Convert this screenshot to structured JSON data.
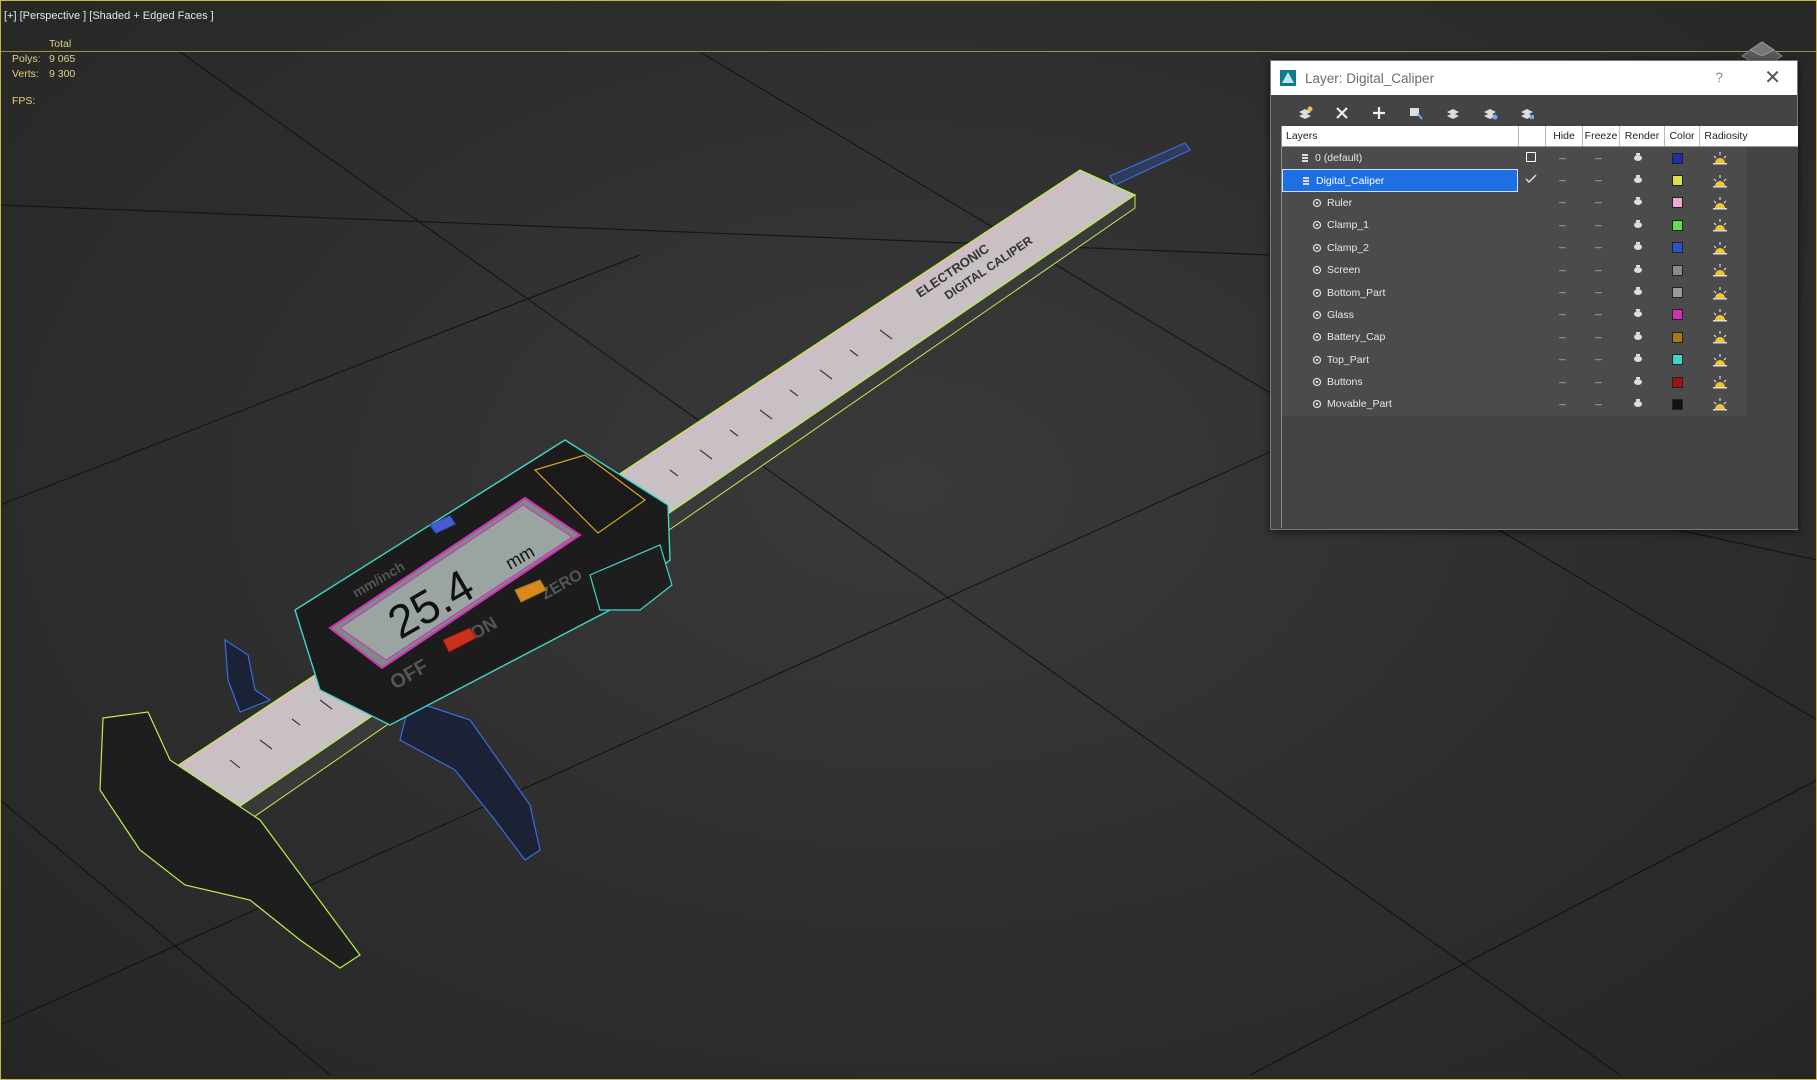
{
  "viewport": {
    "label": "[+] [Perspective ] [Shaded + Edged Faces ]",
    "stats": {
      "total_label": "Total",
      "polys_label": "Polys:",
      "polys_value": "9 065",
      "verts_label": "Verts:",
      "verts_value": "9 300",
      "fps_label": "FPS:"
    },
    "caliper_display_value": "25.4",
    "caliper_display_unit": "mm",
    "caliper_brand_text": "ELECTRONIC",
    "caliper_brand_text2": "DIGITAL CALIPER",
    "caliper_off_label": "OFF",
    "caliper_on_label": "ON",
    "caliper_zero_label": "ZERO",
    "caliper_mode_label": "mm/inch"
  },
  "layer_dialog": {
    "title": "Layer: Digital_Caliper",
    "help_label": "?",
    "close_label": "✕",
    "toolbar": [
      "create-layer-icon",
      "delete-layer-icon",
      "add-to-layer-icon",
      "select-highlighted-icon",
      "highlight-selected-icon",
      "hide-all-icon",
      "freeze-all-icon"
    ],
    "columns": {
      "layers": "Layers",
      "hide": "Hide",
      "freeze": "Freeze",
      "render": "Render",
      "color": "Color",
      "radiosity": "Radiosity"
    },
    "rows": [
      {
        "name": "0 (default)",
        "level": 0,
        "color": "#1a2fa8",
        "current": "box"
      },
      {
        "name": "Digital_Caliper",
        "level": 0,
        "color": "#d9e04a",
        "current": "check",
        "selected": true
      },
      {
        "name": "Ruler",
        "level": 1,
        "color": "#f0a8d8"
      },
      {
        "name": "Clamp_1",
        "level": 1,
        "color": "#5ee04a"
      },
      {
        "name": "Clamp_2",
        "level": 1,
        "color": "#2a57c7"
      },
      {
        "name": "Screen",
        "level": 1,
        "color": "#8a8a8a"
      },
      {
        "name": "Bottom_Part",
        "level": 1,
        "color": "#9a9a9a"
      },
      {
        "name": "Glass",
        "level": 1,
        "color": "#d22fb5"
      },
      {
        "name": "Battery_Cap",
        "level": 1,
        "color": "#a57c12"
      },
      {
        "name": "Top_Part",
        "level": 1,
        "color": "#3fd6c8"
      },
      {
        "name": "Buttons",
        "level": 1,
        "color": "#a31212"
      },
      {
        "name": "Movable_Part",
        "level": 1,
        "color": "#111111"
      }
    ]
  }
}
